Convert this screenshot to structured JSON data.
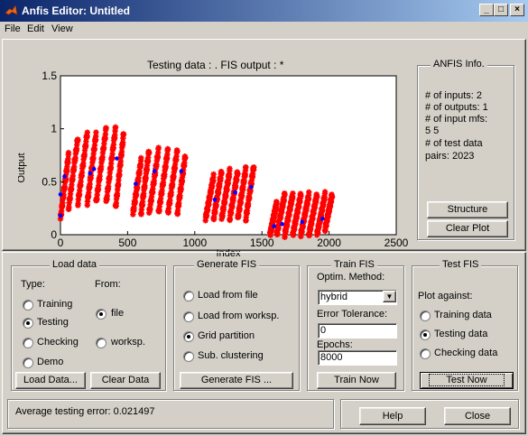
{
  "window": {
    "title": "Anfis Editor: Untitled",
    "min_label": "_",
    "max_label": "□",
    "close_label": "×"
  },
  "menu": [
    "File",
    "Edit",
    "View"
  ],
  "plot": {
    "title": "Testing data : .   FIS output : *",
    "xlabel": "Index",
    "ylabel": "Output",
    "xticks": [
      "0",
      "500",
      "1000",
      "1500",
      "2000",
      "2500"
    ],
    "yticks": [
      "0",
      "0.5",
      "1",
      "1.5"
    ]
  },
  "chart_data": {
    "type": "scatter",
    "title": "Testing data : .   FIS output : *",
    "xlabel": "Index",
    "ylabel": "Output",
    "xlim": [
      0,
      2500
    ],
    "ylim": [
      0,
      1.5
    ],
    "grid": false,
    "series": [
      {
        "marker": "*",
        "color": "#ff0000",
        "segments": [
          {
            "x": [
              0,
              60
            ],
            "y": [
              0.15,
              0.75
            ]
          },
          {
            "x": [
              60,
              130
            ],
            "y": [
              0.25,
              0.92
            ]
          },
          {
            "x": [
              130,
              200
            ],
            "y": [
              0.3,
              0.97
            ]
          },
          {
            "x": [
              200,
              265
            ],
            "y": [
              0.3,
              0.95
            ]
          },
          {
            "x": [
              265,
              340
            ],
            "y": [
              0.3,
              1.0
            ]
          },
          {
            "x": [
              340,
              410
            ],
            "y": [
              0.3,
              1.0
            ]
          },
          {
            "x": [
              410,
              470
            ],
            "y": [
              0.25,
              0.95
            ]
          },
          {
            "x": [
              540,
              600
            ],
            "y": [
              0.2,
              0.7
            ]
          },
          {
            "x": [
              600,
              660
            ],
            "y": [
              0.2,
              0.8
            ]
          },
          {
            "x": [
              660,
              730
            ],
            "y": [
              0.2,
              0.8
            ]
          },
          {
            "x": [
              730,
              800
            ],
            "y": [
              0.2,
              0.8
            ]
          },
          {
            "x": [
              800,
              870
            ],
            "y": [
              0.2,
              0.8
            ]
          },
          {
            "x": [
              870,
              930
            ],
            "y": [
              0.2,
              0.75
            ]
          },
          {
            "x": [
              1080,
              1140
            ],
            "y": [
              0.15,
              0.55
            ]
          },
          {
            "x": [
              1140,
              1200
            ],
            "y": [
              0.15,
              0.6
            ]
          },
          {
            "x": [
              1200,
              1260
            ],
            "y": [
              0.15,
              0.6
            ]
          },
          {
            "x": [
              1260,
              1320
            ],
            "y": [
              0.15,
              0.6
            ]
          },
          {
            "x": [
              1320,
              1380
            ],
            "y": [
              0.15,
              0.62
            ]
          },
          {
            "x": [
              1380,
              1440
            ],
            "y": [
              0.15,
              0.65
            ]
          },
          {
            "x": [
              1560,
              1610
            ],
            "y": [
              0.0,
              0.3
            ]
          },
          {
            "x": [
              1610,
              1670
            ],
            "y": [
              0.0,
              0.38
            ]
          },
          {
            "x": [
              1670,
              1730
            ],
            "y": [
              0.0,
              0.38
            ]
          },
          {
            "x": [
              1730,
              1790
            ],
            "y": [
              0.0,
              0.38
            ]
          },
          {
            "x": [
              1790,
              1850
            ],
            "y": [
              0.0,
              0.38
            ]
          },
          {
            "x": [
              1850,
              1910
            ],
            "y": [
              0.0,
              0.38
            ]
          },
          {
            "x": [
              1910,
              1970
            ],
            "y": [
              0.0,
              0.38
            ]
          },
          {
            "x": [
              1970,
              2023
            ],
            "y": [
              0.05,
              0.38
            ]
          }
        ]
      },
      {
        "marker": "o",
        "color": "#0000ff",
        "points": [
          [
            0,
            0.18
          ],
          [
            0,
            0.38
          ],
          [
            30,
            0.55
          ],
          [
            220,
            0.58
          ],
          [
            250,
            0.62
          ],
          [
            420,
            0.72
          ],
          [
            560,
            0.48
          ],
          [
            700,
            0.6
          ],
          [
            900,
            0.6
          ],
          [
            1150,
            0.33
          ],
          [
            1300,
            0.4
          ],
          [
            1420,
            0.45
          ],
          [
            1590,
            0.08
          ],
          [
            1650,
            0.1
          ],
          [
            1800,
            0.12
          ],
          [
            1950,
            0.15
          ]
        ]
      }
    ]
  },
  "anfis_info": {
    "title": "ANFIS Info.",
    "lines": [
      "# of inputs: 2",
      "# of outputs: 1",
      "# of input mfs:",
      "5  5",
      "# of test data",
      "pairs: 2023"
    ],
    "structure_btn": "Structure",
    "clear_plot_btn": "Clear Plot"
  },
  "load_data": {
    "title": "Load data",
    "type_label": "Type:",
    "from_label": "From:",
    "types": [
      "Training",
      "Testing",
      "Checking",
      "Demo"
    ],
    "selected_type": "Testing",
    "from": [
      "file",
      "worksp."
    ],
    "selected_from": "file",
    "load_btn": "Load Data...",
    "clear_btn": "Clear Data"
  },
  "generate_fis": {
    "title": "Generate FIS",
    "options": [
      "Load from file",
      "Load from worksp.",
      "Grid partition",
      "Sub. clustering"
    ],
    "selected": "Grid partition",
    "generate_btn": "Generate FIS ..."
  },
  "train_fis": {
    "title": "Train FIS",
    "optim_label": "Optim. Method:",
    "optim_value": "hybrid",
    "tol_label": "Error Tolerance:",
    "tol_value": "0",
    "epochs_label": "Epochs:",
    "epochs_value": "8000",
    "train_btn": "Train Now"
  },
  "test_fis": {
    "title": "Test FIS",
    "plot_against": "Plot against:",
    "options": [
      "Training data",
      "Testing data",
      "Checking data"
    ],
    "selected": "Testing data",
    "test_btn": "Test Now"
  },
  "status": {
    "text": "Average testing error: 0.021497"
  },
  "help_btn": "Help",
  "close_btn": "Close"
}
